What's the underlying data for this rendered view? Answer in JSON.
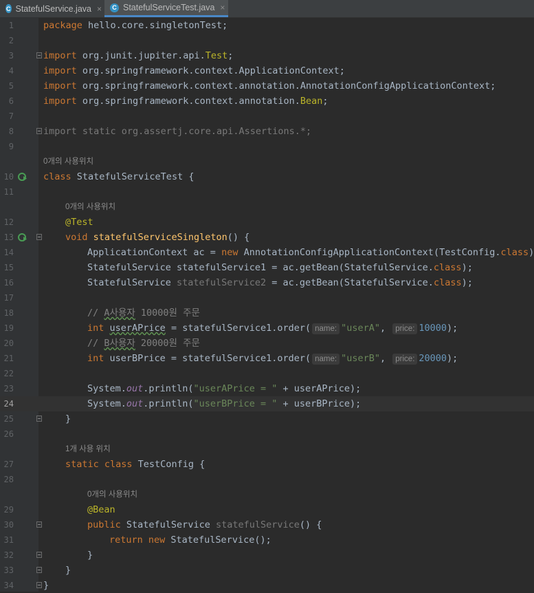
{
  "tabs": [
    {
      "label": "StatefulService.java",
      "icon": "class-icon",
      "active": false
    },
    {
      "label": "StatefulServiceTest.java",
      "icon": "test-class-icon",
      "active": true
    }
  ],
  "colors": {
    "keyword": "#cc7832",
    "string": "#6a8759",
    "number": "#6897bb",
    "annotation": "#bbb529",
    "comment": "#808080",
    "method": "#ffc66d",
    "field": "#9876aa"
  },
  "lines": [
    {
      "n": "1",
      "code": "package hello.core.singletonTest;"
    },
    {
      "n": "2",
      "code": ""
    },
    {
      "n": "3",
      "code": "import org.junit.jupiter.api.Test;"
    },
    {
      "n": "4",
      "code": "import org.springframework.context.ApplicationContext;"
    },
    {
      "n": "5",
      "code": "import org.springframework.context.annotation.AnnotationConfigApplicationContext;"
    },
    {
      "n": "6",
      "code": "import org.springframework.context.annotation.Bean;"
    },
    {
      "n": "7",
      "code": ""
    },
    {
      "n": "8",
      "code": "import static org.assertj.core.api.Assertions.*;"
    },
    {
      "n": "9",
      "code": ""
    },
    {
      "n": "10",
      "code": "class StatefulServiceTest {"
    },
    {
      "n": "11",
      "code": ""
    },
    {
      "n": "12",
      "code": "@Test"
    },
    {
      "n": "13",
      "code": "void statefulServiceSingleton() {"
    },
    {
      "n": "14",
      "code": "ApplicationContext ac = new AnnotationConfigApplicationContext(TestConfig.class);"
    },
    {
      "n": "15",
      "code": "StatefulService statefulService1 = ac.getBean(StatefulService.class);"
    },
    {
      "n": "16",
      "code": "StatefulService statefulService2 = ac.getBean(StatefulService.class);"
    },
    {
      "n": "17",
      "code": ""
    },
    {
      "n": "18",
      "code": "// A사용자 10000원 주문"
    },
    {
      "n": "19",
      "code": "int userAPrice = statefulService1.order( \"userA\", 10000);"
    },
    {
      "n": "20",
      "code": "// B사용자 20000원 주문"
    },
    {
      "n": "21",
      "code": "int userBPrice = statefulService1.order( \"userB\", 20000);"
    },
    {
      "n": "22",
      "code": ""
    },
    {
      "n": "23",
      "code": "System.out.println(\"userAPrice = \" + userAPrice);"
    },
    {
      "n": "24",
      "code": "System.out.println(\"userBPrice = \" + userBPrice);"
    },
    {
      "n": "25",
      "code": "}"
    },
    {
      "n": "26",
      "code": ""
    },
    {
      "n": "27",
      "code": "static class TestConfig {"
    },
    {
      "n": "28",
      "code": ""
    },
    {
      "n": "29",
      "code": "@Bean"
    },
    {
      "n": "30",
      "code": "public StatefulService statefulService() {"
    },
    {
      "n": "31",
      "code": "return new StatefulService();"
    },
    {
      "n": "32",
      "code": "}"
    },
    {
      "n": "33",
      "code": "}"
    },
    {
      "n": "34",
      "code": "}"
    }
  ],
  "usage_hints": {
    "class": "0개의 사용위치",
    "test_method": "0개의 사용위치",
    "config_class": "1개 사용 위치",
    "bean_method": "0개의 사용위치"
  },
  "param_hints": {
    "name": "name:",
    "price": "price:"
  },
  "current_line": "24"
}
